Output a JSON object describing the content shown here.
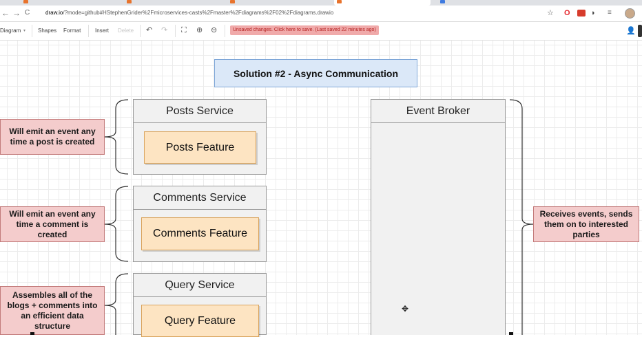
{
  "browser": {
    "url_host": "draw.io",
    "url_path": "/?mode=github#HStephenGrider%2Fmicroservices-casts%2Fmaster%2Fdiagrams%2F02%2Fdiagrams.drawio",
    "back_glyph": "←",
    "forward_glyph": "→",
    "reload_glyph": "C",
    "star_glyph": "☆",
    "opera_glyph": "O",
    "ghost_glyph": "◗",
    "menu_glyph": "≡"
  },
  "toolbar": {
    "diagram_menu": "Diagram",
    "shapes": "Shapes",
    "format": "Format",
    "insert": "Insert",
    "delete": "Delete",
    "undo_glyph": "↶",
    "redo_glyph": "↷",
    "fullscreen_glyph": "⛶",
    "zoom_in_glyph": "⊕",
    "zoom_out_glyph": "⊖",
    "unsaved_message": "Unsaved changes. Click here to save. (Last saved 22 minutes ago)",
    "user_glyph": "👤"
  },
  "diagram": {
    "title": "Solution #2 - Async Communication",
    "services": [
      {
        "name": "Posts Service",
        "feature": "Posts Feature"
      },
      {
        "name": "Comments Service",
        "feature": "Comments Feature"
      },
      {
        "name": "Query Service",
        "feature": "Query Feature"
      }
    ],
    "notes": [
      "Will emit an event any time a post is created",
      "Will emit an event any time a comment is created",
      "Assembles all of the blogs + comments into an efficient data structure",
      "Receives events, sends them on to interested parties"
    ],
    "broker": {
      "name": "Event Broker"
    }
  },
  "colors": {
    "title_fill": "#dbe8f8",
    "feature_fill": "#fde4c2",
    "note_fill": "#f4cccc",
    "service_fill": "#f1f1f1"
  },
  "cursor_glyph": "✥"
}
